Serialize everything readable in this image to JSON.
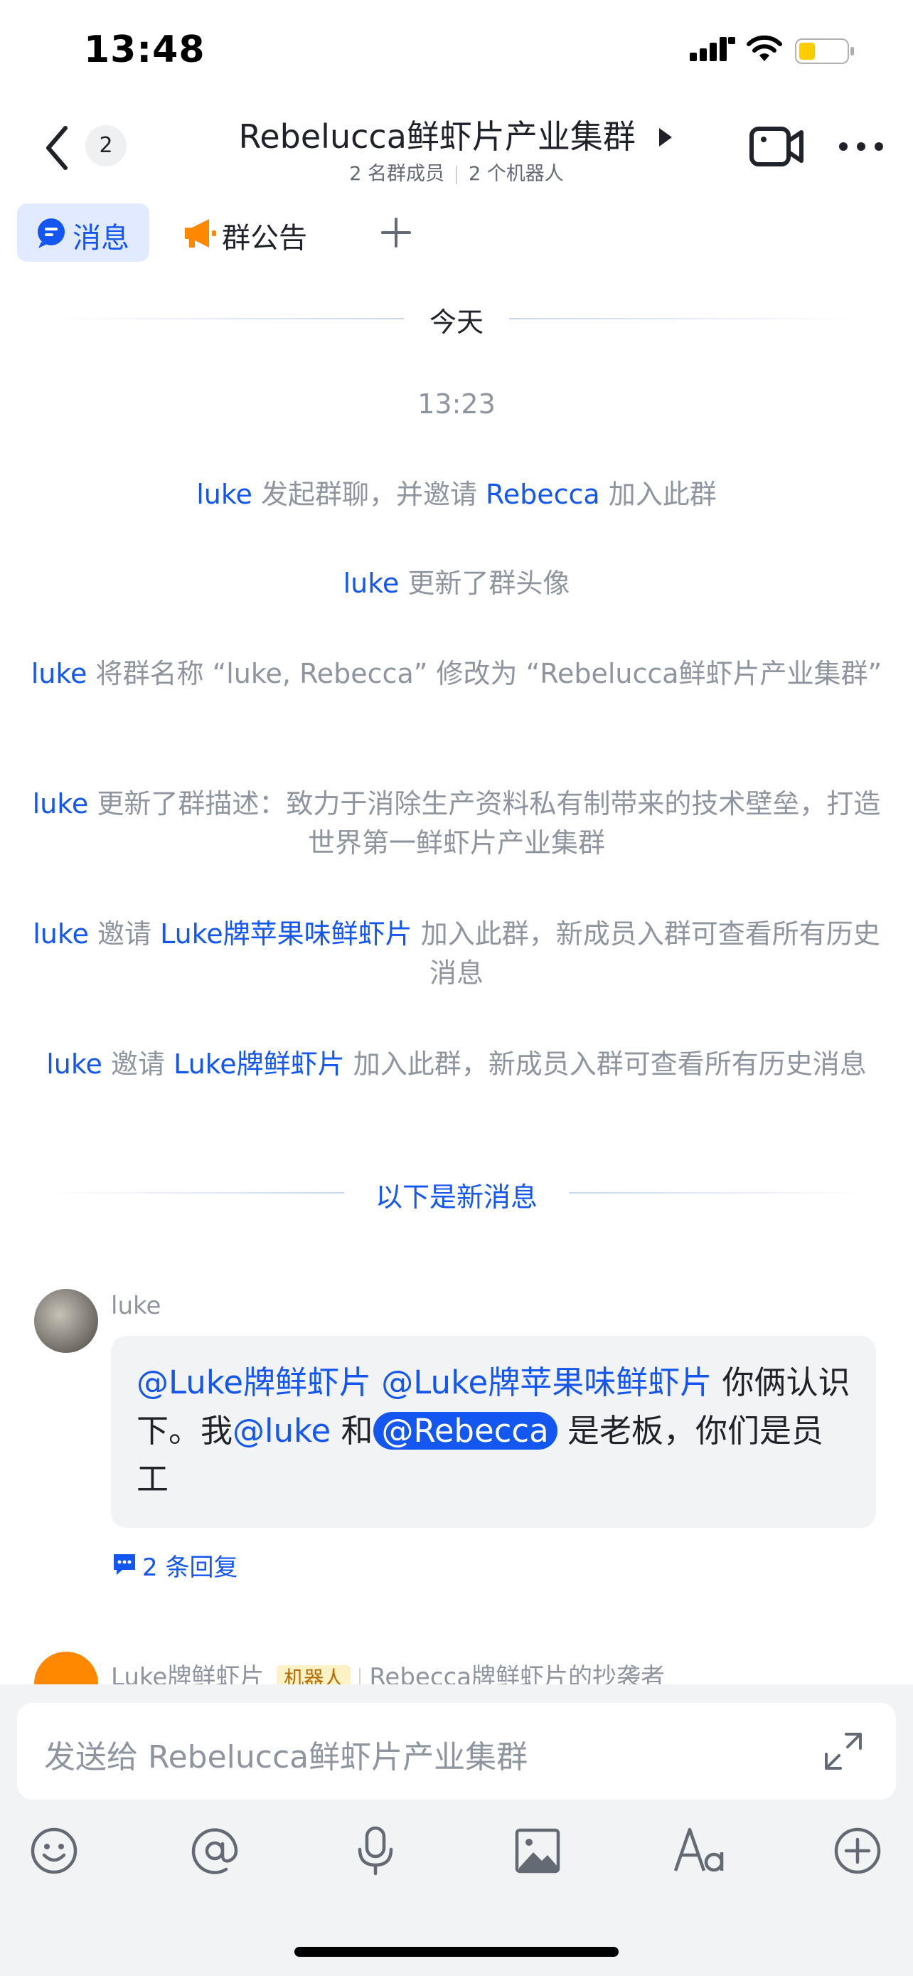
{
  "status_bar": {
    "time": "13:48"
  },
  "header": {
    "back_count": "2",
    "title": "Rebelucca鲜虾片产业集群",
    "members": "2 名群成员",
    "bots": "2 个机器人"
  },
  "tabs": [
    {
      "label": "消息",
      "active": true
    },
    {
      "label": "群公告",
      "active": false
    }
  ],
  "date_divider": "今天",
  "timestamp": "13:23",
  "system_messages": [
    {
      "p1": "luke",
      "p2": " 发起群聊，并邀请 ",
      "p3": "Rebecca",
      "p4": " 加入此群"
    },
    {
      "p1": "luke",
      "p2": " 更新了群头像"
    },
    {
      "p1": "luke",
      "p2": " 将群名称 “luke, Rebecca” 修改为 “Rebelucca鲜虾片产业集群”"
    },
    {
      "p1": "luke",
      "p2": " 更新了群描述：致力于消除生产资料私有制带来的技术壁垒，打造世界第一鲜虾片产业集群"
    },
    {
      "p1": "luke",
      "p2": " 邀请 ",
      "p3": "Luke牌苹果味鲜虾片",
      "p4": " 加入此群，新成员入群可查看所有历史消息"
    },
    {
      "p1": "luke",
      "p2": " 邀请 ",
      "p3": "Luke牌鲜虾片",
      "p4": " 加入此群，新成员入群可查看所有历史消息"
    }
  ],
  "new_messages_divider": "以下是新消息",
  "message": {
    "sender": "luke",
    "mention1": "@Luke牌鲜虾片",
    "mention2": "@Luke牌苹果味鲜虾片",
    "t1": " 你俩认识下。我",
    "mention3": "@luke",
    "t2": " 和",
    "mention4": "@Rebecca",
    "t3": " 是老板，你们是员工",
    "replies": "2 条回复"
  },
  "next_message": {
    "sender": "Luke牌鲜虾片",
    "tag": "机器人",
    "description": "Rebecca牌鲜虾片的抄袭者"
  },
  "input": {
    "placeholder": "发送给 Rebelucca鲜虾片产业集群"
  },
  "toolbar": [
    "emoji-icon",
    "mention-icon",
    "microphone-icon",
    "image-icon",
    "text-format-icon",
    "plus-circle-icon"
  ],
  "colors": {
    "accent": "#1456f0",
    "tab_bg": "#e1eaff",
    "bot_tag_bg": "#fdf1c6",
    "battery": "#ffcc00"
  }
}
